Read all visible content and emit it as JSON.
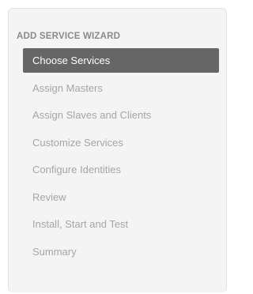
{
  "wizard": {
    "title": "ADD SERVICE WIZARD",
    "active_index": 0,
    "steps": [
      {
        "label": "Choose Services"
      },
      {
        "label": "Assign Masters"
      },
      {
        "label": "Assign Slaves and Clients"
      },
      {
        "label": "Customize Services"
      },
      {
        "label": "Configure Identities"
      },
      {
        "label": "Review"
      },
      {
        "label": "Install, Start and Test"
      },
      {
        "label": "Summary"
      }
    ]
  },
  "colors": {
    "active_background": "#666666",
    "active_text": "#ffffff",
    "inactive_text": "#a6a6a6",
    "title_text": "#8a8a8a",
    "panel_background": "#f4f4f4"
  }
}
